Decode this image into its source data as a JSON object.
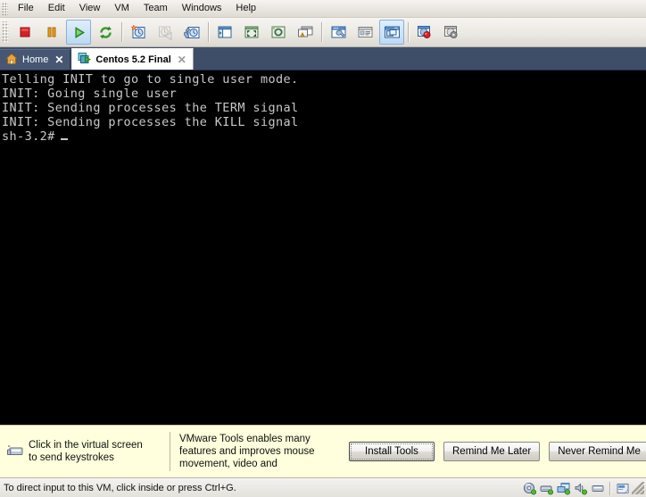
{
  "menubar": {
    "items": [
      {
        "label": "File"
      },
      {
        "label": "Edit"
      },
      {
        "label": "View"
      },
      {
        "label": "VM"
      },
      {
        "label": "Team"
      },
      {
        "label": "Windows"
      },
      {
        "label": "Help"
      }
    ]
  },
  "toolbar": {
    "groups": [
      {
        "buttons": [
          {
            "name": "power-off-button",
            "icon": "stop-icon",
            "state": "enabled"
          },
          {
            "name": "suspend-button",
            "icon": "pause-icon",
            "state": "enabled"
          },
          {
            "name": "power-on-button",
            "icon": "play-icon",
            "state": "active"
          },
          {
            "name": "reset-button",
            "icon": "reset-icon",
            "state": "enabled"
          }
        ]
      },
      {
        "buttons": [
          {
            "name": "take-snapshot-button",
            "icon": "snapshot-take-icon",
            "state": "enabled"
          },
          {
            "name": "revert-snapshot-button",
            "icon": "snapshot-revert-icon",
            "state": "disabled"
          },
          {
            "name": "snapshot-manager-button",
            "icon": "snapshot-manager-icon",
            "state": "enabled"
          }
        ]
      },
      {
        "buttons": [
          {
            "name": "show-sidebar-button",
            "icon": "sidebar-icon",
            "state": "enabled"
          },
          {
            "name": "fullscreen-button",
            "icon": "fullscreen-icon",
            "state": "enabled"
          },
          {
            "name": "quick-switch-button",
            "icon": "quickswitch-icon",
            "state": "enabled"
          },
          {
            "name": "unity-button",
            "icon": "unity-icon",
            "state": "enabled"
          }
        ]
      },
      {
        "buttons": [
          {
            "name": "vm-settings-button",
            "icon": "wrench-window-icon",
            "state": "enabled"
          },
          {
            "name": "vm-summary-button",
            "icon": "summary-window-icon",
            "state": "enabled"
          },
          {
            "name": "vm-console-button",
            "icon": "console-window-icon",
            "state": "active"
          }
        ]
      },
      {
        "buttons": [
          {
            "name": "record-button",
            "icon": "record-window-icon",
            "state": "enabled"
          },
          {
            "name": "replay-button",
            "icon": "replay-window-icon",
            "state": "enabled"
          }
        ]
      }
    ]
  },
  "tabs": [
    {
      "label": "Home",
      "icon": "home-icon",
      "active": false,
      "close": "✕"
    },
    {
      "label": "Centos 5.2 Final",
      "icon": "vm-running-icon",
      "active": true,
      "close": "✕"
    }
  ],
  "vm_console": {
    "lines": [
      "Telling INIT to go to single user mode.",
      "INIT: Going single user",
      "INIT: Sending processes the TERM signal",
      "INIT: Sending processes the KILL signal"
    ],
    "prompt": "sh-3.2#",
    "background_color": "#000000",
    "text_color": "#c8c8c8"
  },
  "notification": {
    "icon": "keyboard-icon",
    "hint_line1": "Click in the virtual screen",
    "hint_line2": "to send keystrokes",
    "tools_line1": "VMware Tools enables many",
    "tools_line2": "features and improves mouse",
    "tools_line3": "movement, video and",
    "buttons": [
      {
        "name": "install-tools-button",
        "label": "Install Tools",
        "focused": true
      },
      {
        "name": "remind-me-later-button",
        "label": "Remind Me Later",
        "focused": false
      },
      {
        "name": "never-remind-me-button",
        "label": "Never Remind Me",
        "focused": false
      }
    ],
    "background_color": "#ffffdd"
  },
  "statusbar": {
    "message": "To direct input to this VM, click inside or press Ctrl+G.",
    "icons": [
      {
        "name": "cdrom-status-icon"
      },
      {
        "name": "harddisk-status-icon"
      },
      {
        "name": "network-status-icon"
      },
      {
        "name": "sound-status-icon"
      },
      {
        "name": "usb-status-icon"
      },
      {
        "name": "message-log-icon"
      }
    ]
  },
  "colors": {
    "tabbar_bg": "#3f4e68",
    "toolbar_bg": "#ebe9e3",
    "accent_blue": "#3f7fbf",
    "notify_bg": "#ffffdd"
  }
}
